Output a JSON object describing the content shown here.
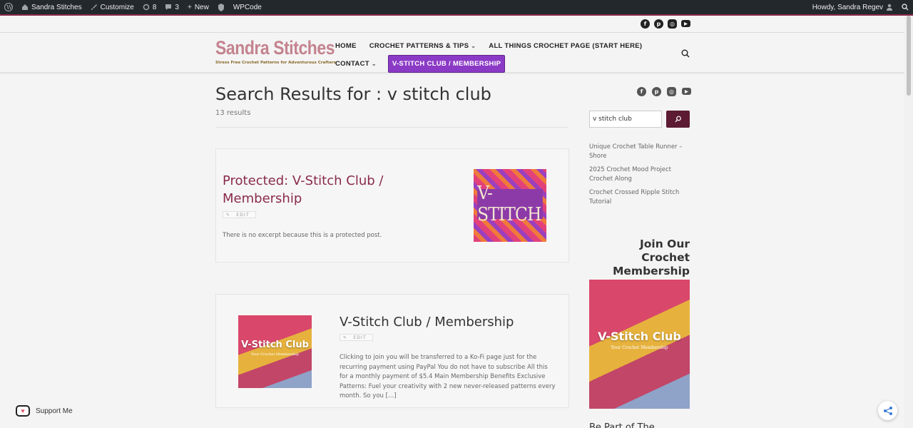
{
  "admin_bar": {
    "site_name": "Sandra Stitches",
    "customize": "Customize",
    "updates_count": "8",
    "comments_count": "3",
    "new_label": "New",
    "wpcode": "WPCode",
    "howdy": "Howdy, Sandra Regev"
  },
  "header": {
    "logo_title": "Sandra Stitches",
    "logo_tagline": "Stress Free Crochet Patterns for Adventurous Crafters",
    "nav": {
      "home": "HOME",
      "crochet_patterns": "CROCHET PATTERNS & TIPS",
      "all_things": "ALL THINGS CROCHET PAGE (START HERE)",
      "contact": "CONTACT",
      "vstitch": "V-STITCH CLUB / MEMBERSHIP"
    }
  },
  "social_icons": [
    "facebook-icon",
    "pinterest-icon",
    "instagram-icon",
    "youtube-icon"
  ],
  "main": {
    "search_title": "Search Results for : v stitch club",
    "result_count": "13 results",
    "results": [
      {
        "title": "Protected: V-Stitch Club / Membership",
        "edit_label": "EDIT",
        "excerpt": "There is no excerpt because this is a protected post.",
        "thumb_text": "V-STITCH"
      },
      {
        "title": "V-Stitch Club / Membership",
        "edit_label": "EDIT",
        "excerpt": "Clicking to join you will be transferred to a Ko-Fi page just for the recurring payment using PayPal You do not have to subscribe All this for a monthly payment of $5.4 Main Membership Benefits Exclusive Patterns: Fuel your creativity with 2 new never-released patterns every month. So you […]",
        "thumb_text": "V-Stitch Club",
        "thumb_sub": "Your Crochet Membership"
      }
    ]
  },
  "sidebar": {
    "search_value": "v stitch club",
    "recent_posts": [
      "Unique Crochet Table Runner – Shore",
      "2025 Crochet Mood Project Crochet Along",
      "Crochet Crossed Ripple Stitch Tutorial"
    ],
    "membership_heading": "Join Our Crochet Membership",
    "membership_image_text": "V-Stitch Club",
    "membership_image_sub": "Your Crochet Membership",
    "more_heading": "Be Part of The"
  },
  "floating": {
    "support_label": "Support Me"
  },
  "colors": {
    "accent": "#8a2b4a",
    "vstitch_button": "#8b3ac6",
    "search_button": "#5c1a33",
    "admin_bar": "#23282d"
  }
}
